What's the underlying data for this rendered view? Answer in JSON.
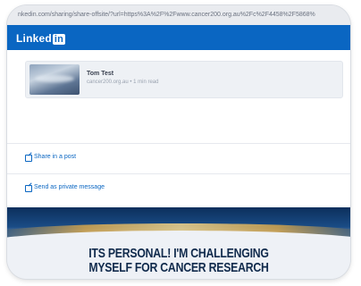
{
  "browser": {
    "url": "nkedin.com/sharing/share-offsite/?url=https%3A%2F%2Fwww.cancer200.org.au%2Fc%2F4458%2F5868%"
  },
  "header": {
    "logo_text": "Linked",
    "logo_in": "in",
    "brand_color": "#0a66c2"
  },
  "share_card": {
    "title": "Tom Test",
    "subtitle": "cancer200.org.au • 1 min read"
  },
  "options": [
    {
      "label": "Share in a post",
      "icon": "compose-icon"
    },
    {
      "label": "Send as private message",
      "icon": "compose-icon"
    }
  ],
  "banner": {
    "line1": "ITS PERSONAL! I'M CHALLENGING",
    "line2": "MYSELF FOR CANCER RESEARCH"
  }
}
